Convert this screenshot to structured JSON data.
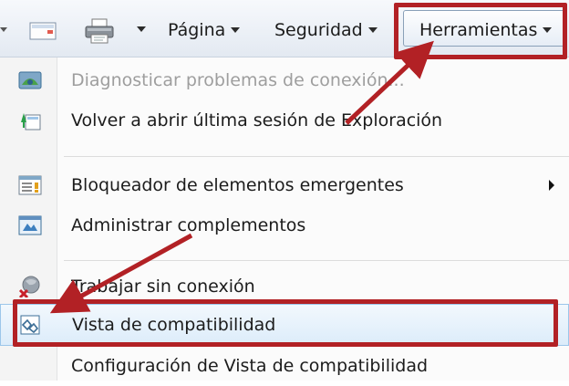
{
  "toolbar": {
    "page_label": "Página",
    "safety_label": "Seguridad",
    "tools_label": "Herramientas",
    "icons": [
      "feeds-icon",
      "print-icon"
    ]
  },
  "menu": {
    "items": [
      {
        "label": "Diagnosticar problemas de conexión...",
        "icon": "diagnose-connection-icon",
        "disabled": true
      },
      {
        "label": "Volver a abrir última sesión de Exploración",
        "icon": "reopen-session-icon",
        "disabled": false
      },
      {
        "label": "Bloqueador de elementos emergentes",
        "icon": "popup-blocker-icon",
        "disabled": false,
        "submenu": true
      },
      {
        "label": "Administrar complementos",
        "icon": "manage-addons-icon",
        "disabled": false
      },
      {
        "label": "Trabajar sin conexión",
        "icon": "work-offline-icon",
        "disabled": false
      },
      {
        "label": "Vista de compatibilidad",
        "icon": "compatibility-view-icon",
        "disabled": false,
        "hover": true
      },
      {
        "label": "Configuración de Vista de compatibilidad",
        "icon": "",
        "disabled": false
      }
    ]
  },
  "colors": {
    "annotation_red": "#b22125",
    "hover_blue": "#9cc6ea",
    "disabled_text": "#9e9e9e"
  }
}
